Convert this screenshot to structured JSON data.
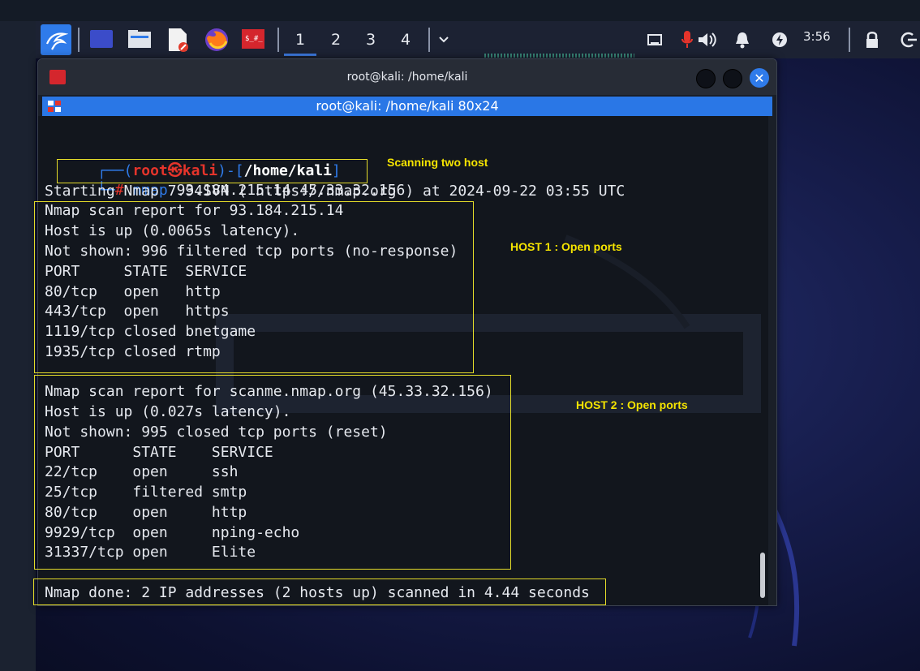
{
  "panel": {
    "workspaces": [
      "1",
      "2",
      "3",
      "4"
    ],
    "active_workspace": "1",
    "clock": "3:56",
    "icons": [
      "kali-menu-icon",
      "show-desktop-icon",
      "file-manager-icon",
      "text-editor-icon",
      "firefox-icon",
      "terminal-launcher-icon",
      "chevron-down-icon",
      "screen-icon",
      "microphone-icon",
      "volume-icon",
      "notification-bell-icon",
      "power-icon",
      "lock-icon",
      "logout-icon"
    ]
  },
  "window": {
    "title": "root@kali: /home/kali",
    "tab_title": "root@kali: /home/kali 80x24",
    "prompt": {
      "user": "root",
      "skull": "㉿",
      "host": "kali",
      "dir": "/home/kali",
      "hash": "#",
      "command": "nmap",
      "args": " 93.184.215.14 45.33.32.156"
    },
    "lines": {
      "start": "Starting Nmap 7.94SVN ( https://nmap.org ) at 2024-09-22 03:55 UTC",
      "h1": [
        "Nmap scan report for 93.184.215.14",
        "Host is up (0.0065s latency).",
        "Not shown: 996 filtered tcp ports (no-response)",
        "PORT     STATE  SERVICE",
        "80/tcp   open   http",
        "443/tcp  open   https",
        "1119/tcp closed bnetgame",
        "1935/tcp closed rtmp"
      ],
      "h2": [
        "Nmap scan report for scanme.nmap.org (45.33.32.156)",
        "Host is up (0.027s latency).",
        "Not shown: 995 closed tcp ports (reset)",
        "PORT      STATE    SERVICE",
        "22/tcp    open     ssh",
        "25/tcp    filtered smtp",
        "80/tcp    open     http",
        "9929/tcp  open     nping-echo",
        "31337/tcp open     Elite"
      ],
      "done": "Nmap done: 2 IP addresses (2 hosts up) scanned in 4.44 seconds"
    }
  },
  "annotations": {
    "scan": "Scanning  two host",
    "host1": "HOST 1 : Open ports",
    "host2": "HOST 2 : Open ports"
  },
  "colors": {
    "accent_blue": "#2a77e6",
    "prompt_red": "#e5342b",
    "annotation_yellow": "#f5e400",
    "terminal_bg": "#12161d"
  }
}
